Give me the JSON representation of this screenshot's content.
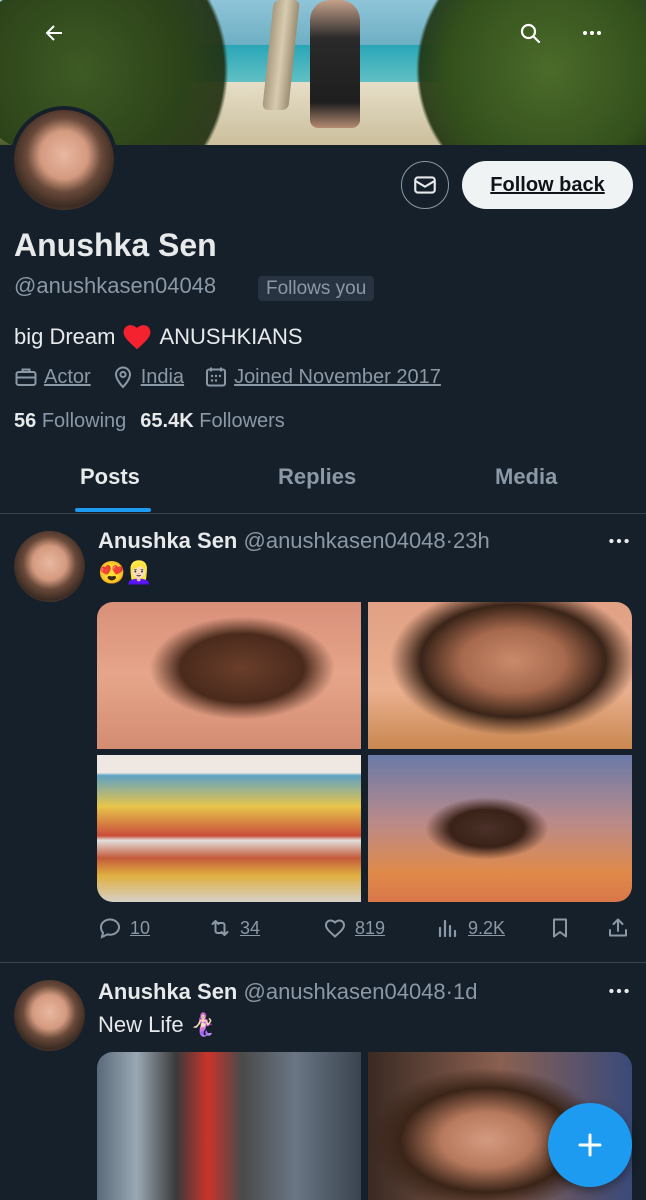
{
  "profile": {
    "name": "Anushka Sen",
    "handle": "@anushkasen04048",
    "follows_you": "Follows you",
    "bio_start": "big Dream",
    "bio_end": "ANUSHKIANS",
    "profession": "Actor",
    "location": "India",
    "joined": "Joined November 2017",
    "following_count": "56",
    "following_label": "Following",
    "followers_count": "65.4K",
    "followers_label": "Followers"
  },
  "buttons": {
    "follow_back": "Follow back"
  },
  "tabs": [
    {
      "label": "Posts",
      "active": true
    },
    {
      "label": "Replies",
      "active": false
    },
    {
      "label": "Media",
      "active": false
    }
  ],
  "posts": [
    {
      "name": "Anushka Sen",
      "handle": "@anushkasen04048",
      "time": "23h",
      "text": "😍👱🏻‍♀️",
      "replies": "10",
      "reposts": "34",
      "likes": "819",
      "views": "9.2K"
    },
    {
      "name": "Anushka Sen",
      "handle": "@anushkasen04048",
      "time": "1d",
      "text": "New Life 🧜🏻‍♀️"
    }
  ],
  "colors": {
    "background": "#15202b",
    "accent": "#1d9bf0",
    "text_primary": "#e7e9ea",
    "text_secondary": "#8b98a5",
    "heart": "#f4212e"
  }
}
